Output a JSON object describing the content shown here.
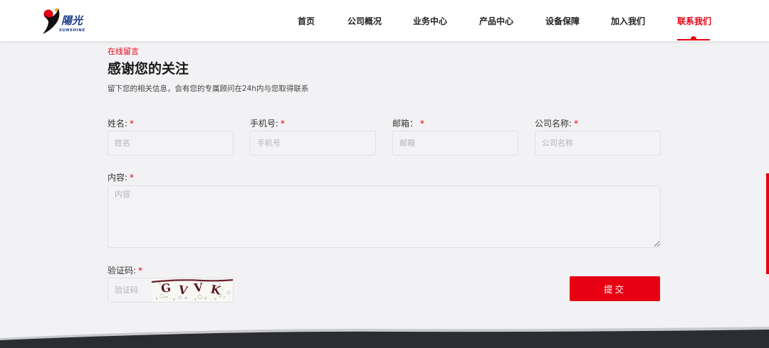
{
  "header": {
    "logo_text": "陽光",
    "logo_subtext": "SUNSHINE",
    "nav": [
      {
        "label": "首页",
        "active": false
      },
      {
        "label": "公司概况",
        "active": false
      },
      {
        "label": "业务中心",
        "active": false
      },
      {
        "label": "产品中心",
        "active": false
      },
      {
        "label": "设备保障",
        "active": false
      },
      {
        "label": "加入我们",
        "active": false
      },
      {
        "label": "联系我们",
        "active": true
      }
    ]
  },
  "form": {
    "eyebrow": "在线留言",
    "title": "感谢您的关注",
    "subtitle": "留下您的相关信息，会有您的专属顾问在24h内与您取得联系",
    "required_mark": "*",
    "name": {
      "label": "姓名:",
      "placeholder": "姓名",
      "value": ""
    },
    "phone": {
      "label": "手机号:",
      "placeholder": "手机号",
      "value": ""
    },
    "email": {
      "label": "邮箱：",
      "placeholder": "邮箱",
      "value": ""
    },
    "company": {
      "label": "公司名称:",
      "placeholder": "公司名称",
      "value": ""
    },
    "content": {
      "label": "内容:",
      "placeholder": "内容",
      "value": ""
    },
    "captcha": {
      "label": "验证码:",
      "placeholder": "验证码",
      "value": "",
      "image_text": "GVVK"
    },
    "submit_label": "提交"
  },
  "colors": {
    "accent": "#e60012",
    "page_bg": "#f2f2f4",
    "footer": "#2b2d33"
  }
}
